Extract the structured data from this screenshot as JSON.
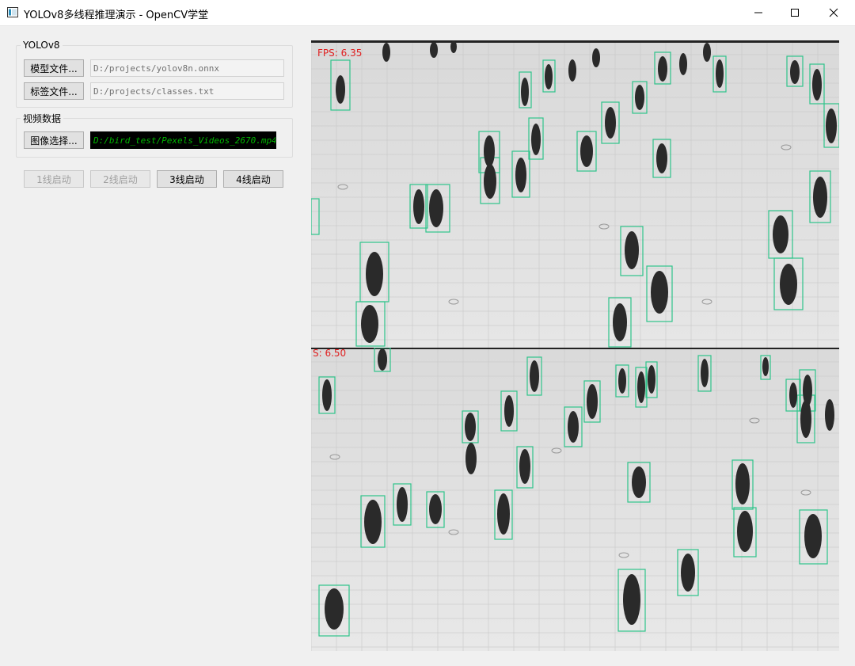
{
  "window": {
    "title": "YOLOv8多线程推理演示 - OpenCV学堂",
    "icon": "app-window-icon"
  },
  "model_group": {
    "title": "YOLOv8",
    "model_button": "模型文件...",
    "model_path": "D:/projects/yolov8n.onnx",
    "label_button": "标签文件...",
    "label_path": "D:/projects/classes.txt"
  },
  "video_group": {
    "title": "视频数据",
    "select_button": "图像选择...",
    "video_path": "D:/bird_test/Pexels_Videos_2670.mp4"
  },
  "launch_buttons": [
    {
      "label": "1线启动",
      "enabled": false
    },
    {
      "label": "2线启动",
      "enabled": false
    },
    {
      "label": "3线启动",
      "enabled": true
    },
    {
      "label": "4线启动",
      "enabled": true
    }
  ],
  "panels": [
    {
      "fps_label": "FPS: 6.35"
    },
    {
      "fps_label": "S: 6.50"
    }
  ],
  "colors": {
    "box": "#2ec48a",
    "fps": "#e02020",
    "video_field_text": "#00b400"
  }
}
